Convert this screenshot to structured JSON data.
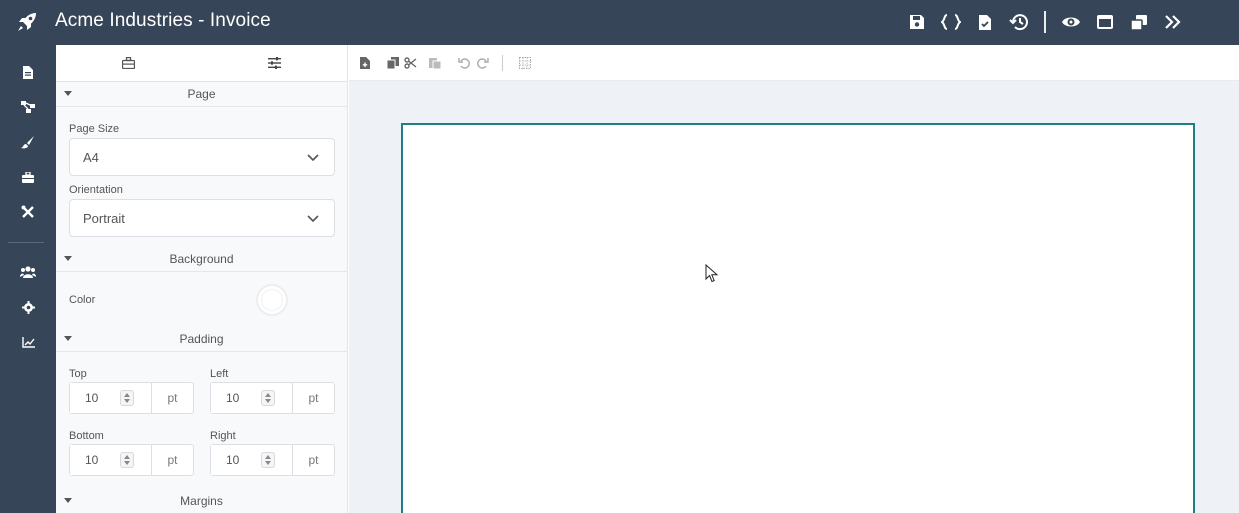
{
  "app": {
    "title": "Acme Industries - Invoice",
    "logo_icon": "rocket-icon",
    "colors": {
      "topbar": "#364558",
      "page_border": "#1f7e86",
      "canvas_bg": "#eef1f5"
    }
  },
  "top_actions": [
    {
      "name": "save-button",
      "icon": "save-icon"
    },
    {
      "name": "code-button",
      "icon": "braces-icon"
    },
    {
      "name": "validate-button",
      "icon": "file-check-icon"
    },
    {
      "name": "history-button",
      "icon": "history-icon"
    },
    {
      "name": "preview-button",
      "icon": "eye-icon"
    },
    {
      "name": "window-button",
      "icon": "window-icon"
    },
    {
      "name": "clone-button",
      "icon": "clone-icon"
    },
    {
      "name": "next-button",
      "icon": "double-chevron-right-icon"
    }
  ],
  "rail": [
    {
      "name": "rail-document",
      "icon": "file-icon"
    },
    {
      "name": "rail-structure",
      "icon": "sitemap-icon"
    },
    {
      "name": "rail-style",
      "icon": "brush-icon"
    },
    {
      "name": "rail-components",
      "icon": "toolbox-icon"
    },
    {
      "name": "rail-tools",
      "icon": "tools-icon"
    },
    {
      "name": "rail-users",
      "icon": "users-icon"
    },
    {
      "name": "rail-settings",
      "icon": "gear-icon"
    },
    {
      "name": "rail-analytics",
      "icon": "chart-line-icon"
    }
  ],
  "panel": {
    "tabs": [
      {
        "name": "tab-components",
        "icon": "toolbox-icon"
      },
      {
        "name": "tab-properties",
        "icon": "sliders-icon"
      }
    ],
    "sections": {
      "page": "Page",
      "background": "Background",
      "padding": "Padding",
      "margins": "Margins"
    },
    "page_size": {
      "label": "Page Size",
      "value": "A4"
    },
    "orientation": {
      "label": "Orientation",
      "value": "Portrait"
    },
    "background_color": {
      "label": "Color",
      "value": "#ffffff"
    },
    "padding": {
      "top": {
        "label": "Top",
        "value": "10",
        "unit": "pt"
      },
      "left": {
        "label": "Left",
        "value": "10",
        "unit": "pt"
      },
      "bottom": {
        "label": "Bottom",
        "value": "10",
        "unit": "pt"
      },
      "right": {
        "label": "Right",
        "value": "10",
        "unit": "pt"
      }
    }
  },
  "canvas_toolbar": [
    {
      "name": "new-page-button",
      "icon": "file-plus-icon"
    },
    {
      "name": "copy-button",
      "icon": "copy-icon"
    },
    {
      "name": "cut-button",
      "icon": "scissors-icon"
    },
    {
      "name": "paste-button",
      "icon": "paste-icon"
    },
    {
      "name": "undo-button",
      "icon": "undo-icon"
    },
    {
      "name": "redo-button",
      "icon": "redo-icon"
    },
    {
      "name": "grid-button",
      "icon": "grid-icon"
    }
  ]
}
